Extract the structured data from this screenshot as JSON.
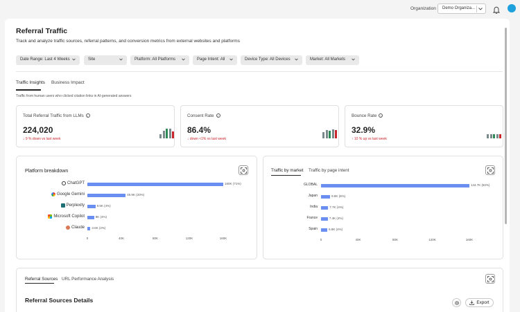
{
  "header": {
    "org_label": "Organization",
    "org_value": "Demo Organiza...",
    "notification_icon": "bell-icon",
    "avatar_color": "#1ea0dc"
  },
  "page": {
    "title": "Referral Traffic",
    "description": "Track and analyze traffic sources, referral patterns, and conversion metrics from external websites and platforms"
  },
  "filters": [
    {
      "label": "Date Range: Last 4 Weeks"
    },
    {
      "label": "Site"
    },
    {
      "label": "Platform: All Platforms"
    },
    {
      "label": "Page Intent: All"
    },
    {
      "label": "Device Type: All Devices"
    },
    {
      "label": "Market: All Markets"
    }
  ],
  "tabs": [
    {
      "label": "Traffic Insights",
      "active": true
    },
    {
      "label": "Business Impact",
      "active": false
    }
  ],
  "tabs_hint": "Traffic from human users who clicked citation links in AI-generated answers",
  "kpis": [
    {
      "label": "Total Referral Traffic from LLMs",
      "value": "224,020",
      "delta": "↓ 9 % down vs last week"
    },
    {
      "label": "Consent Rate",
      "value": "86.4%",
      "delta": "↓ down <1% vs last week"
    },
    {
      "label": "Bounce Rate",
      "value": "32.9%",
      "delta": "↑ 10 % up vs last week"
    }
  ],
  "colors": {
    "accent_bar": "#6a8ff0",
    "negative": "#c9252c",
    "mini_neutral": "#7a8a8a",
    "mini_green": "#2e8b57"
  },
  "platform_panel": {
    "title": "Platform breakdown",
    "focus_icon": "focus-icon"
  },
  "market_panel": {
    "tabs": [
      {
        "label": "Traffic by market",
        "active": true
      },
      {
        "label": "Traffic by page intent",
        "active": false
      }
    ],
    "focus_icon": "focus-icon"
  },
  "chart_data": [
    {
      "type": "bar",
      "orientation": "horizontal",
      "categories": [
        "ChatGPT",
        "Google Gemini",
        "Perplexity",
        "Microsoft Copilot",
        "Claude"
      ],
      "values": [
        160000,
        45000,
        9500,
        8000,
        3600
      ],
      "value_labels": [
        "160K (71%)",
        "45.9K (20%)",
        "9.5K (4%)",
        "8K (4%)",
        "3.6K (2%)"
      ],
      "x_ticks": [
        "0",
        "40K",
        "80K",
        "120K",
        "160K"
      ],
      "xlim": [
        0,
        160000
      ]
    },
    {
      "type": "bar",
      "orientation": "horizontal",
      "categories": [
        "GLOBAL",
        "Japan",
        "India",
        "France",
        "Spain"
      ],
      "values": [
        160000,
        9800,
        7700,
        7400,
        6800
      ],
      "value_labels": [
        "144.7K (82%)",
        "9.8K (6%)",
        "7.7K (4%)",
        "7.4K (4%)",
        "6.8K (4%)"
      ],
      "x_ticks": [
        "0",
        "40K",
        "80K",
        "120K",
        "160K"
      ],
      "xlim": [
        0,
        160000
      ]
    }
  ],
  "bottom_panel": {
    "tabs": [
      {
        "label": "Referral Sources",
        "active": true
      },
      {
        "label": "URL Performance Analysis",
        "active": false
      }
    ],
    "section_title": "Referral Sources Details",
    "export_label": "Export",
    "settings_icon": "gear-icon",
    "export_icon": "download-icon"
  }
}
